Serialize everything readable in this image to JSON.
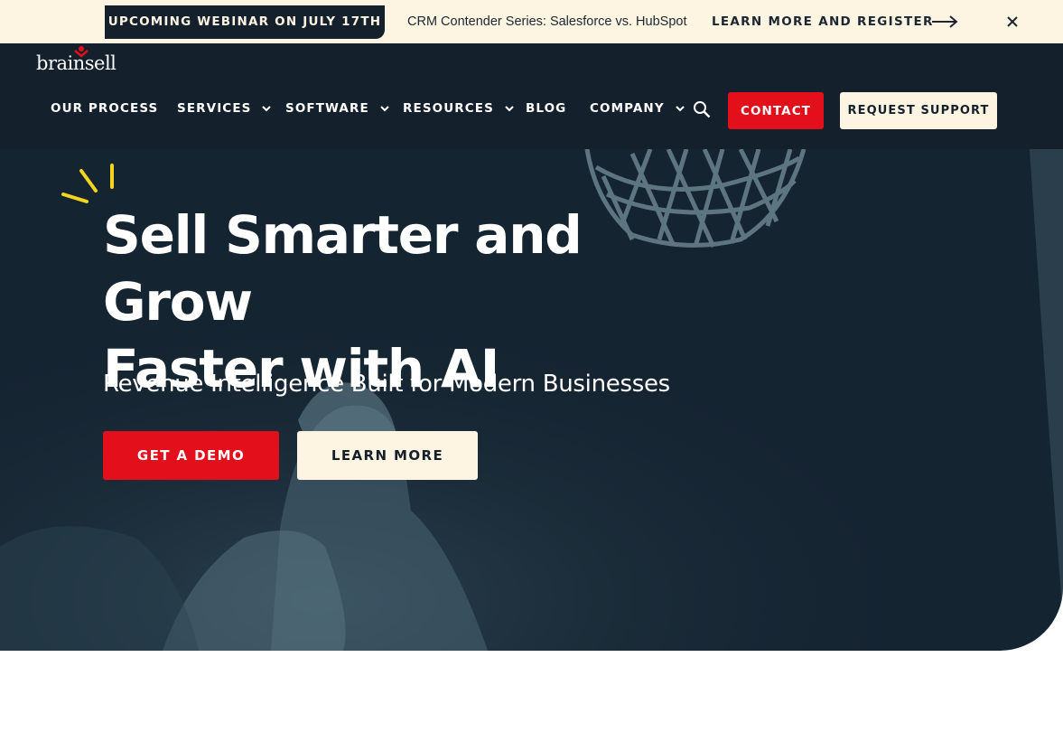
{
  "announcement": {
    "badge": "UPCOMING WEBINAR ON JULY 17TH",
    "teaser": "CRM Contender Series: Salesforce vs. HubSpot",
    "link_label": "LEARN MORE AND REGISTER",
    "arrow_icon": "arrow-right-icon",
    "close_icon": "close-icon"
  },
  "header": {
    "logo_text": "brainsell",
    "nav": [
      {
        "label": "OUR PROCESS",
        "has_dropdown": false
      },
      {
        "label": "SERVICES",
        "has_dropdown": true
      },
      {
        "label": "SOFTWARE",
        "has_dropdown": true
      },
      {
        "label": "RESOURCES",
        "has_dropdown": true
      },
      {
        "label": "BLOG",
        "has_dropdown": false
      },
      {
        "label": "COMPANY",
        "has_dropdown": true
      }
    ],
    "search_icon": "search-icon",
    "contact_label": "CONTACT",
    "support_label": "REQUEST SUPPORT"
  },
  "hero": {
    "title_line1": "Sell Smarter and Grow",
    "title_line2": "Faster with AI",
    "subtitle": "Revenue Intelligence Built for Modern Businesses",
    "primary_cta": "GET A DEMO",
    "secondary_cta": "LEARN MORE",
    "background_image": "basketball-player-dunk-photo"
  },
  "colors": {
    "navy": "#14212d",
    "cream": "#fdf5e1",
    "red": "#e3101c",
    "accent_yellow": "#f2d51c"
  }
}
